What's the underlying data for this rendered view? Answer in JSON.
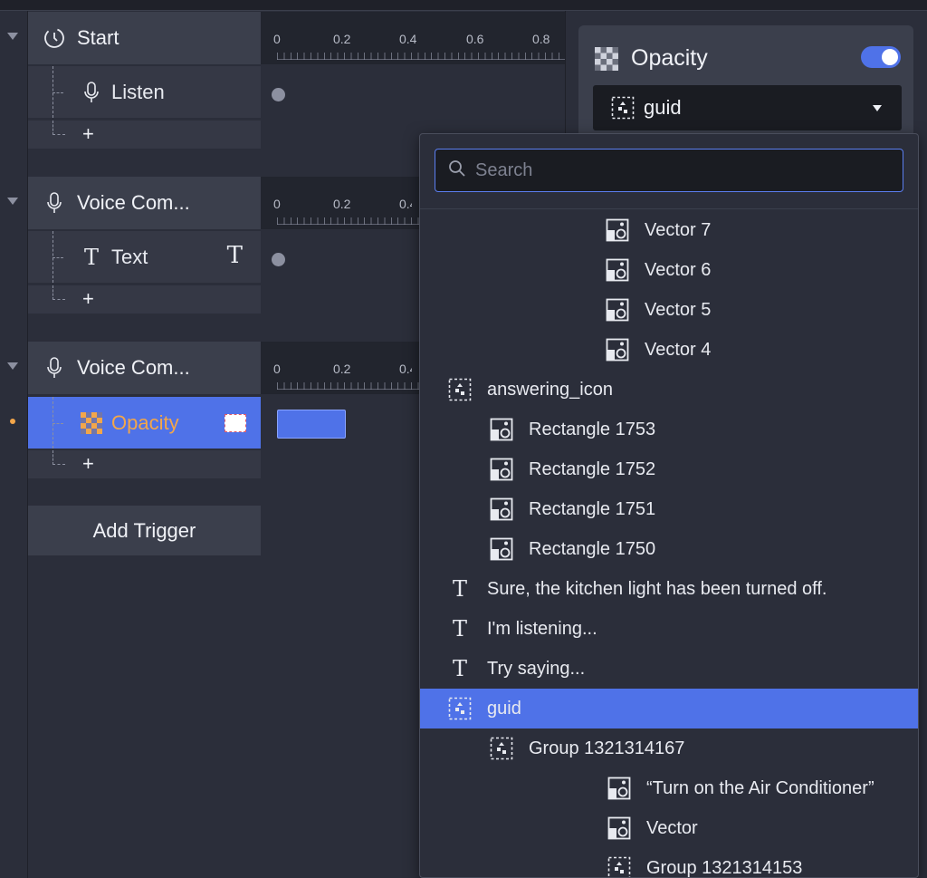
{
  "timeline": {
    "ticks": [
      "0",
      "0.2",
      "0.4",
      "0.6",
      "0.8"
    ],
    "groups": [
      {
        "header": "Start",
        "header_icon": "clock-icon",
        "rows": [
          {
            "label": "Listen",
            "icon": "microphone-icon"
          }
        ],
        "add_label": "+"
      },
      {
        "header": "Voice Com...",
        "header_icon": "microphone-icon",
        "rows": [
          {
            "label": "Text",
            "icon": "text-icon",
            "badge": "T"
          }
        ],
        "add_label": "+"
      },
      {
        "header": "Voice Com...",
        "header_icon": "microphone-icon",
        "rows": [
          {
            "label": "Opacity",
            "icon": "opacity-icon",
            "selected": true
          }
        ],
        "add_label": "+"
      }
    ],
    "add_trigger_label": "Add Trigger"
  },
  "property": {
    "title": "Opacity",
    "toggle_on": true,
    "layer_value": "guid"
  },
  "dropdown": {
    "search_placeholder": "Search",
    "items": [
      {
        "label": "Vector 7",
        "icon": "image-layer-icon",
        "level": "lvl3v"
      },
      {
        "label": "Vector 6",
        "icon": "image-layer-icon",
        "level": "lvl3v"
      },
      {
        "label": "Vector 5",
        "icon": "image-layer-icon",
        "level": "lvl3v"
      },
      {
        "label": "Vector 4",
        "icon": "image-layer-icon",
        "level": "lvl3v"
      },
      {
        "label": "answering_icon",
        "icon": "group-icon",
        "level": "lvl1"
      },
      {
        "label": "Rectangle 1753",
        "icon": "image-layer-icon",
        "level": "lvl2"
      },
      {
        "label": "Rectangle 1752",
        "icon": "image-layer-icon",
        "level": "lvl2"
      },
      {
        "label": "Rectangle 1751",
        "icon": "image-layer-icon",
        "level": "lvl2"
      },
      {
        "label": "Rectangle 1750",
        "icon": "image-layer-icon",
        "level": "lvl2"
      },
      {
        "label": "Sure, the kitchen light has been turned off.",
        "icon": "text-icon",
        "level": "lvl1"
      },
      {
        "label": "I'm listening...",
        "icon": "text-icon",
        "level": "lvl1"
      },
      {
        "label": "Try saying...",
        "icon": "text-icon",
        "level": "lvl1"
      },
      {
        "label": "guid",
        "icon": "group-icon",
        "level": "lvl1",
        "selected": true
      },
      {
        "label": "Group 1321314167",
        "icon": "group-icon",
        "level": "lvl2"
      },
      {
        "label": "“Turn on the Air Conditioner”",
        "icon": "image-layer-icon",
        "level": "lvl4b"
      },
      {
        "label": "Vector",
        "icon": "image-layer-icon",
        "level": "lvl4b"
      },
      {
        "label": "Group 1321314153",
        "icon": "group-icon",
        "level": "lvl4b"
      }
    ]
  },
  "colors": {
    "accent": "#4f72e8",
    "highlight_text": "#f3a64a",
    "panel": "#3b3f4c",
    "background": "#2b2e3a"
  }
}
